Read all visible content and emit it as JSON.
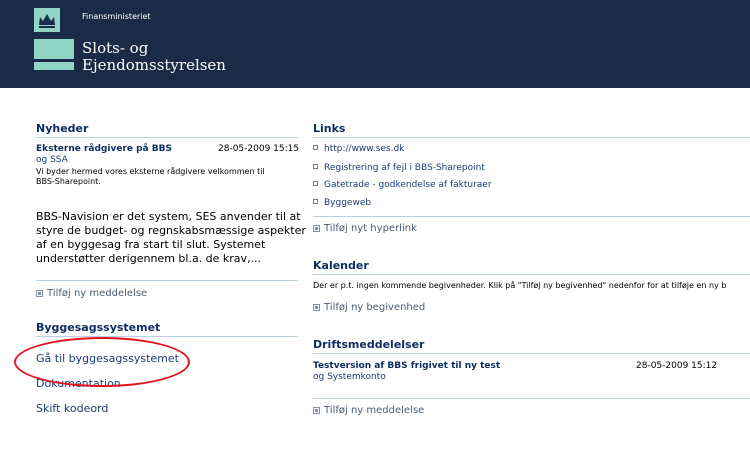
{
  "header": {
    "ministry": "Finansministeriet",
    "org_line1": "Slots- og",
    "org_line2": "Ejendomsstyrelsen"
  },
  "news": {
    "title": "Nyheder",
    "item_title": "Eksterne rådgivere på BBS",
    "item_date": "28-05-2009 15:15",
    "item_author": "og SSA",
    "item_summary_1": "Vi byder hermed vores eksterne rådgivere velkommen til",
    "item_summary_2": "BBS-Sharepoint.",
    "body_1": "BBS-Navision er det system, SES anvender til at",
    "body_2": "styre de budget- og regnskabsmæssige aspekter",
    "body_3": "af en byggesag fra start til slut. Systemet",
    "body_4": "understøtter derigennem bl.a. de krav,...",
    "add_label": "Tilføj ny meddelelse"
  },
  "byggesag": {
    "title": "Byggesagssystemet",
    "links": [
      "Gå til byggesagssystemet",
      "Dokumentation",
      "Skift kodeord"
    ]
  },
  "links": {
    "title": "Links",
    "items": [
      "http://www.ses.dk",
      "Registrering af fejl i BBS-Sharepoint",
      "Gatetrade - godkendelse af fakturaer",
      "Byggeweb"
    ],
    "add_label": "Tilføj nyt hyperlink"
  },
  "calendar": {
    "title": "Kalender",
    "empty_text": "Der er p.t. ingen kommende begivenheder. Klik på \"Tilføj ny begivenhed\" nedenfor for at tilføje en ny b",
    "add_label": "Tilføj ny begivenhed"
  },
  "drift": {
    "title": "Driftsmeddelelser",
    "item_title": "Testversion af BBS frigivet til ny test",
    "item_date": "28-05-2009 15:12",
    "item_author": "og Systemkonto",
    "add_label": "Tilføj ny meddelelse"
  },
  "colors": {
    "header_bg": "#1b2b47",
    "accent": "#8fd4c4",
    "title_blue": "#0a2d5f",
    "annotation_red": "#e0141e"
  }
}
